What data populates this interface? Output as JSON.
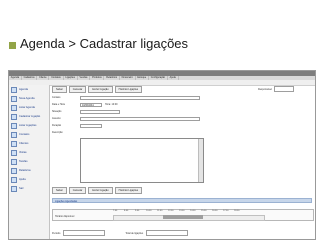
{
  "slide": {
    "title": "Agenda > Cadastrar ligações"
  },
  "menubar": [
    "Agenda",
    "Cadastros",
    "Cliente",
    "Contatos",
    "Ligações",
    "Vendas",
    "Produtos",
    "Relatórios",
    "Financeiro",
    "Estoque",
    "Configuração",
    "Ajuda"
  ],
  "subbar": "Administrador",
  "sidebar": {
    "items": [
      "Agenda",
      "Nova Agenda",
      "Listar Agenda",
      "Cadastrar Ligação",
      "Listar Ligações",
      "Contatos",
      "Clientes",
      "Visitas",
      "Tarefas",
      "Relatórios",
      "Ajuda",
      "Sair"
    ]
  },
  "toolbar_top": [
    "Salvar",
    "Cancelar",
    "Excluir Ligação",
    "Histórico Ligações"
  ],
  "toolbar_bottom": [
    "Salvar",
    "Cancelar",
    "Excluir Ligação",
    "Histórico Ligações"
  ],
  "right_field": {
    "label": "Responsável"
  },
  "form": {
    "rows": [
      {
        "label": "Contato",
        "value": ""
      },
      {
        "label": "Data e Hora",
        "value": "10/06/2011",
        "extra": "Hora: 10:00"
      },
      {
        "label": "Situação",
        "value": ""
      },
      {
        "label": "Assunto",
        "value": ""
      },
      {
        "label": "Duração",
        "value": ""
      },
      {
        "label": "Descrição",
        "value": ""
      }
    ]
  },
  "section_header": "Ligações Agendadas",
  "timeline": {
    "hours": [
      "7:00",
      "8:00",
      "9:00",
      "10:00",
      "11:00",
      "12:00",
      "13:00",
      "14:00",
      "15:00",
      "16:00",
      "17:00",
      "18:00"
    ],
    "label": "Horário disponível",
    "occupied": {
      "start": "17:00",
      "end": "18:00"
    }
  },
  "bottom_row": {
    "left_label": "Período",
    "right_label": "Total de ligações"
  }
}
